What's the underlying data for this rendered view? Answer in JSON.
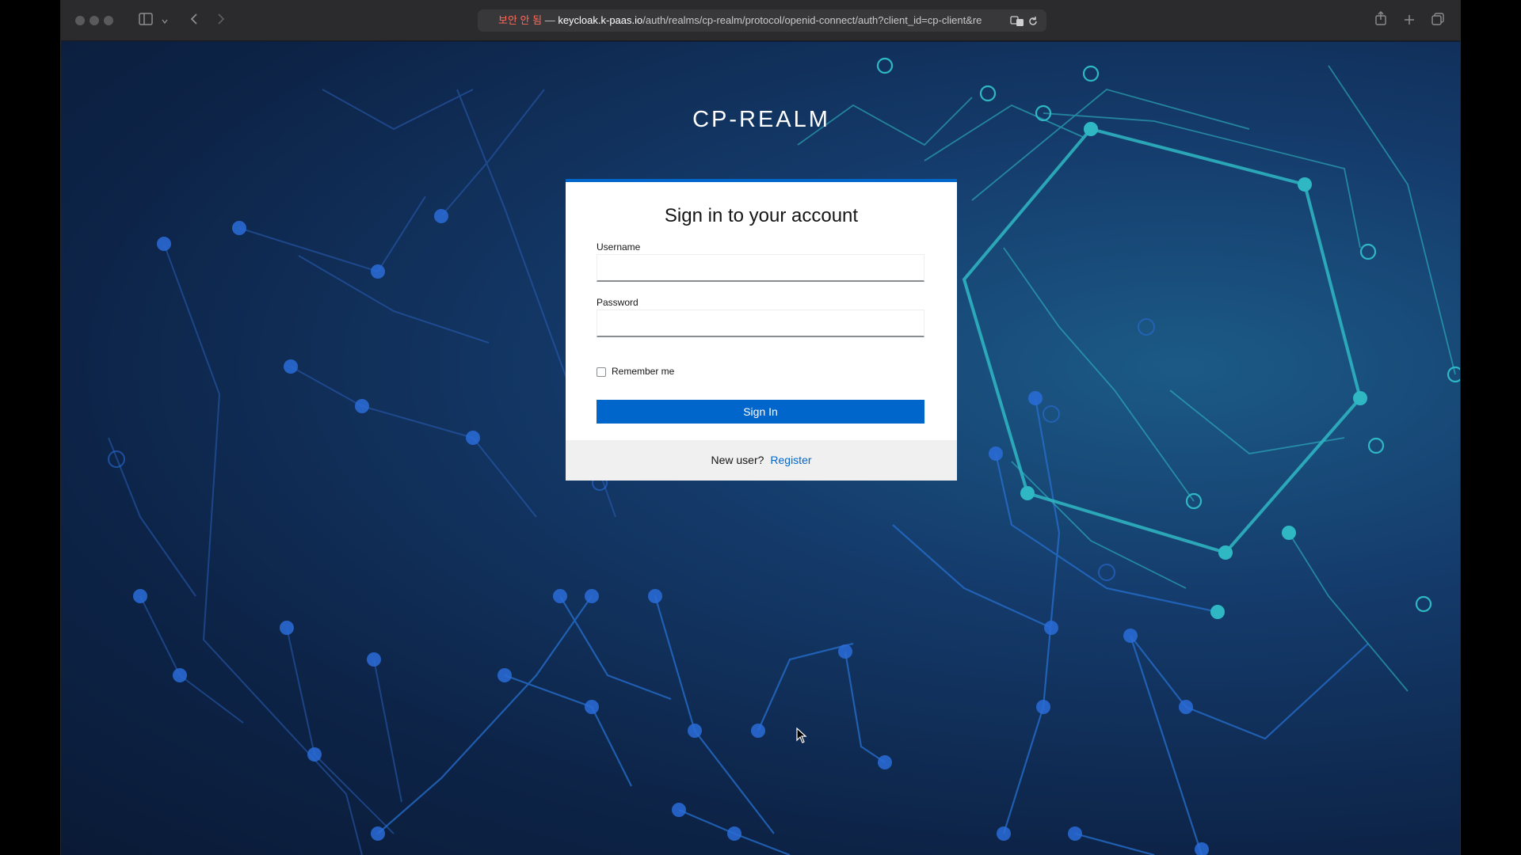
{
  "browser": {
    "url_insecure_label": "보안 안 됨",
    "url_separator": " — ",
    "url_host": "keycloak.k-paas.io",
    "url_path": "/auth/realms/cp-realm/protocol/openid-connect/auth?client_id=cp-client&re",
    "icons": [
      "sidebar-icon",
      "chevron-down-icon",
      "back-icon",
      "forward-icon",
      "translate-icon",
      "reload-icon",
      "share-icon",
      "new-tab-icon",
      "tabs-overview-icon"
    ]
  },
  "page": {
    "realm_name": "CP-REALM",
    "login": {
      "title": "Sign in to your account",
      "username_label": "Username",
      "username_value": "",
      "password_label": "Password",
      "password_value": "",
      "remember_me_label": "Remember me",
      "remember_me_checked": false,
      "sign_in_label": "Sign In",
      "new_user_text": "New user?",
      "register_label": "Register"
    }
  },
  "colors": {
    "accent": "#0066cc",
    "background_dark": "#0d2448",
    "network_teal": "#2fb8c4",
    "network_blue": "#2a6cd8"
  }
}
